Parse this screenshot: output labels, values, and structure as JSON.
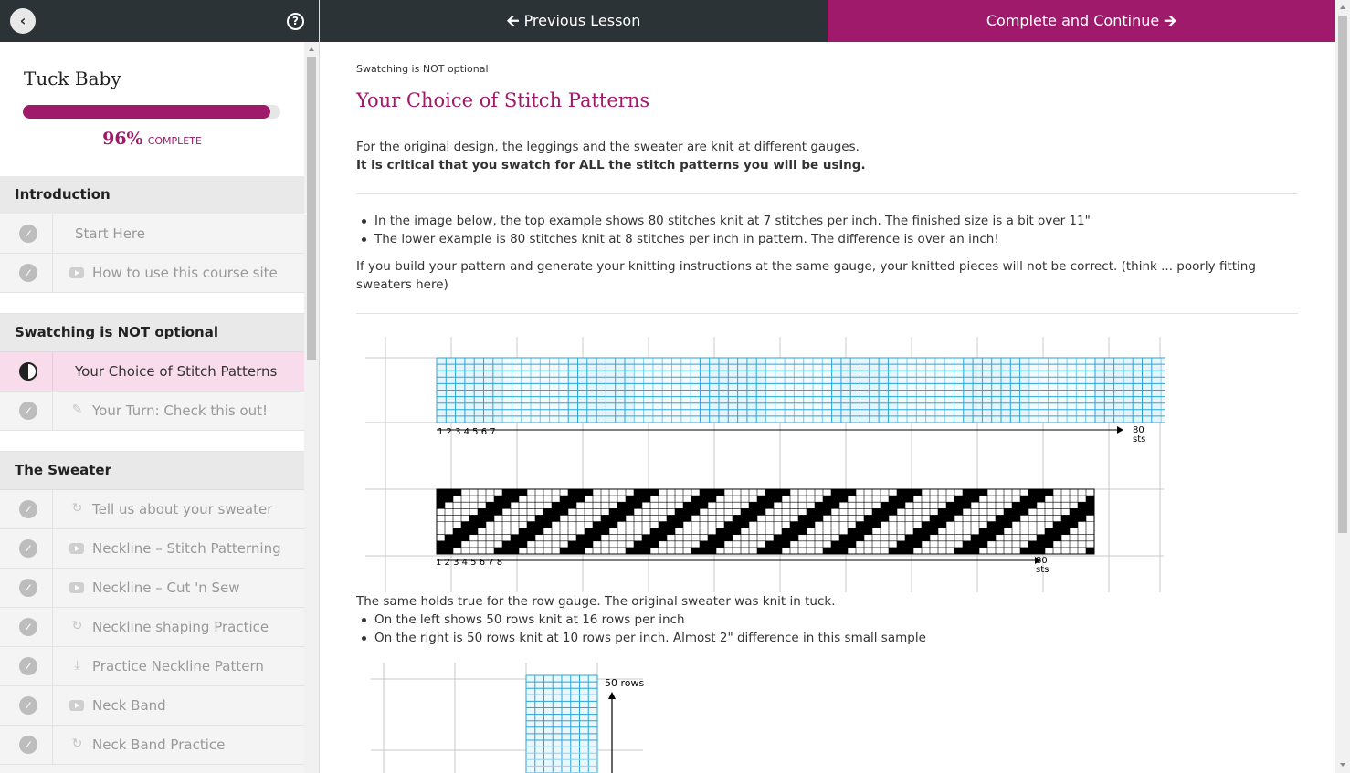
{
  "sidebar": {
    "course_title": "Tuck Baby",
    "progress": {
      "percent_value": 96,
      "percent": "96%",
      "label": "COMPLETE"
    },
    "sections": [
      {
        "title": "Introduction",
        "lessons": [
          {
            "label": "Start Here",
            "status": "complete",
            "type": "text"
          },
          {
            "label": "How to use this course site",
            "status": "complete",
            "type": "video"
          }
        ]
      },
      {
        "title": "Swatching is NOT optional",
        "lessons": [
          {
            "label": "Your Choice of Stitch Patterns",
            "status": "in-progress",
            "type": "text"
          },
          {
            "label": "Your Turn: Check this out!",
            "status": "complete",
            "type": "edit"
          }
        ]
      },
      {
        "title": "The Sweater",
        "lessons": [
          {
            "label": "Tell us about your sweater",
            "status": "complete",
            "type": "survey"
          },
          {
            "label": "Neckline – Stitch Patterning",
            "status": "complete",
            "type": "video"
          },
          {
            "label": "Neckline – Cut 'n Sew",
            "status": "complete",
            "type": "video"
          },
          {
            "label": "Neckline shaping Practice",
            "status": "complete",
            "type": "survey"
          },
          {
            "label": "Practice Neckline Pattern",
            "status": "complete",
            "type": "download"
          },
          {
            "label": "Neck Band",
            "status": "complete",
            "type": "video"
          },
          {
            "label": "Neck Band Practice",
            "status": "complete",
            "type": "survey"
          }
        ]
      }
    ]
  },
  "nav": {
    "previous_label": "Previous Lesson",
    "next_label": "Complete and Continue"
  },
  "main": {
    "breadcrumb": "Swatching is NOT optional",
    "title": "Your Choice of Stitch Patterns",
    "intro_line1": "For the original design, the leggings and the sweater are knit at different gauges.",
    "intro_line2": "It is critical that you swatch for ALL the stitch patterns you will be using.",
    "bullets1": [
      "In the image below, the top example shows 80 stitches knit at 7 stitches per inch. The finished size is a bit over 11\"",
      "The lower example is 80 stitches knit at 8 stitches per inch in pattern. The difference is over an inch!"
    ],
    "para2_line1": "If you build your pattern and generate your knitting instructions at the same gauge, your knitted pieces will not be correct. (think ... poorly fitting",
    "para2_line2": "sweaters here)",
    "figure1": {
      "top_numbers": "1 2 3 4 5 6 7",
      "top_end": "80",
      "top_unit": "sts",
      "bottom_numbers": "1 2 3 4 5 6 7 8",
      "bottom_end": "80",
      "bottom_unit": "sts"
    },
    "para3": "The same holds true for the row gauge. The original sweater was knit in tuck.",
    "bullets2": [
      "On the left shows 50 rows knit at 16 rows per inch",
      "On the right is 50 rows knit at 10 rows per inch. Almost 2\" difference in this small sample"
    ],
    "figure2": {
      "label": "50 rows"
    }
  },
  "colors": {
    "accent": "#a01a6b",
    "dark": "#2b3336",
    "grid_blue": "#2aa5d8",
    "active_bg": "#f9dcec"
  }
}
